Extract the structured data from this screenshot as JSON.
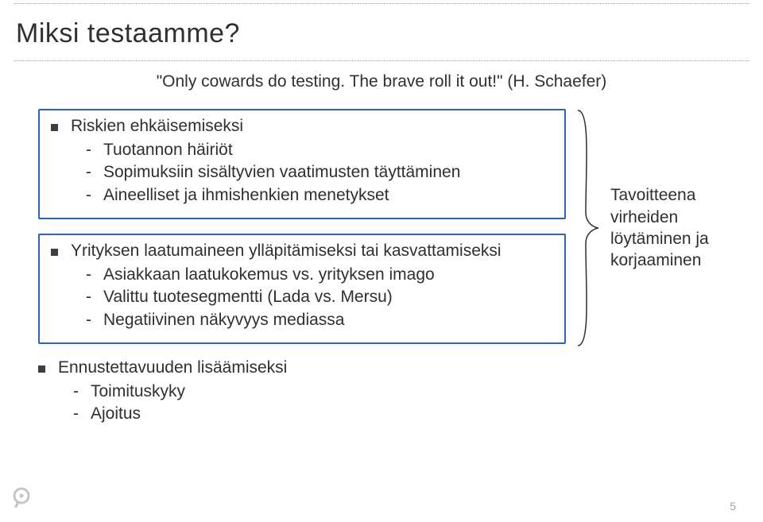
{
  "title": "Miksi testaamme?",
  "quote": "\"Only cowards do testing. The brave roll it out!\" (H. Schaefer)",
  "boxes": [
    {
      "heading": "Riskien ehkäisemiseksi",
      "items": [
        "Tuotannon häiriöt",
        "Sopimuksiin sisältyvien vaatimusten täyttäminen",
        "Aineelliset ja ihmishenkien menetykset"
      ]
    },
    {
      "heading": "Yrityksen laatumaineen ylläpitämiseksi tai kasvattamiseksi",
      "items": [
        "Asiakkaan laatukokemus vs. yrityksen imago",
        "Valittu tuotesegmentti (Lada vs. Mersu)",
        "Negatiivinen näkyvyys mediassa"
      ]
    }
  ],
  "summary": "Tavoitteena virheiden löytäminen ja korjaaminen",
  "footer": {
    "heading": "Ennustettavuuden lisäämiseksi",
    "items": [
      "Toimituskyky",
      "Ajoitus"
    ]
  },
  "page_number": "5"
}
